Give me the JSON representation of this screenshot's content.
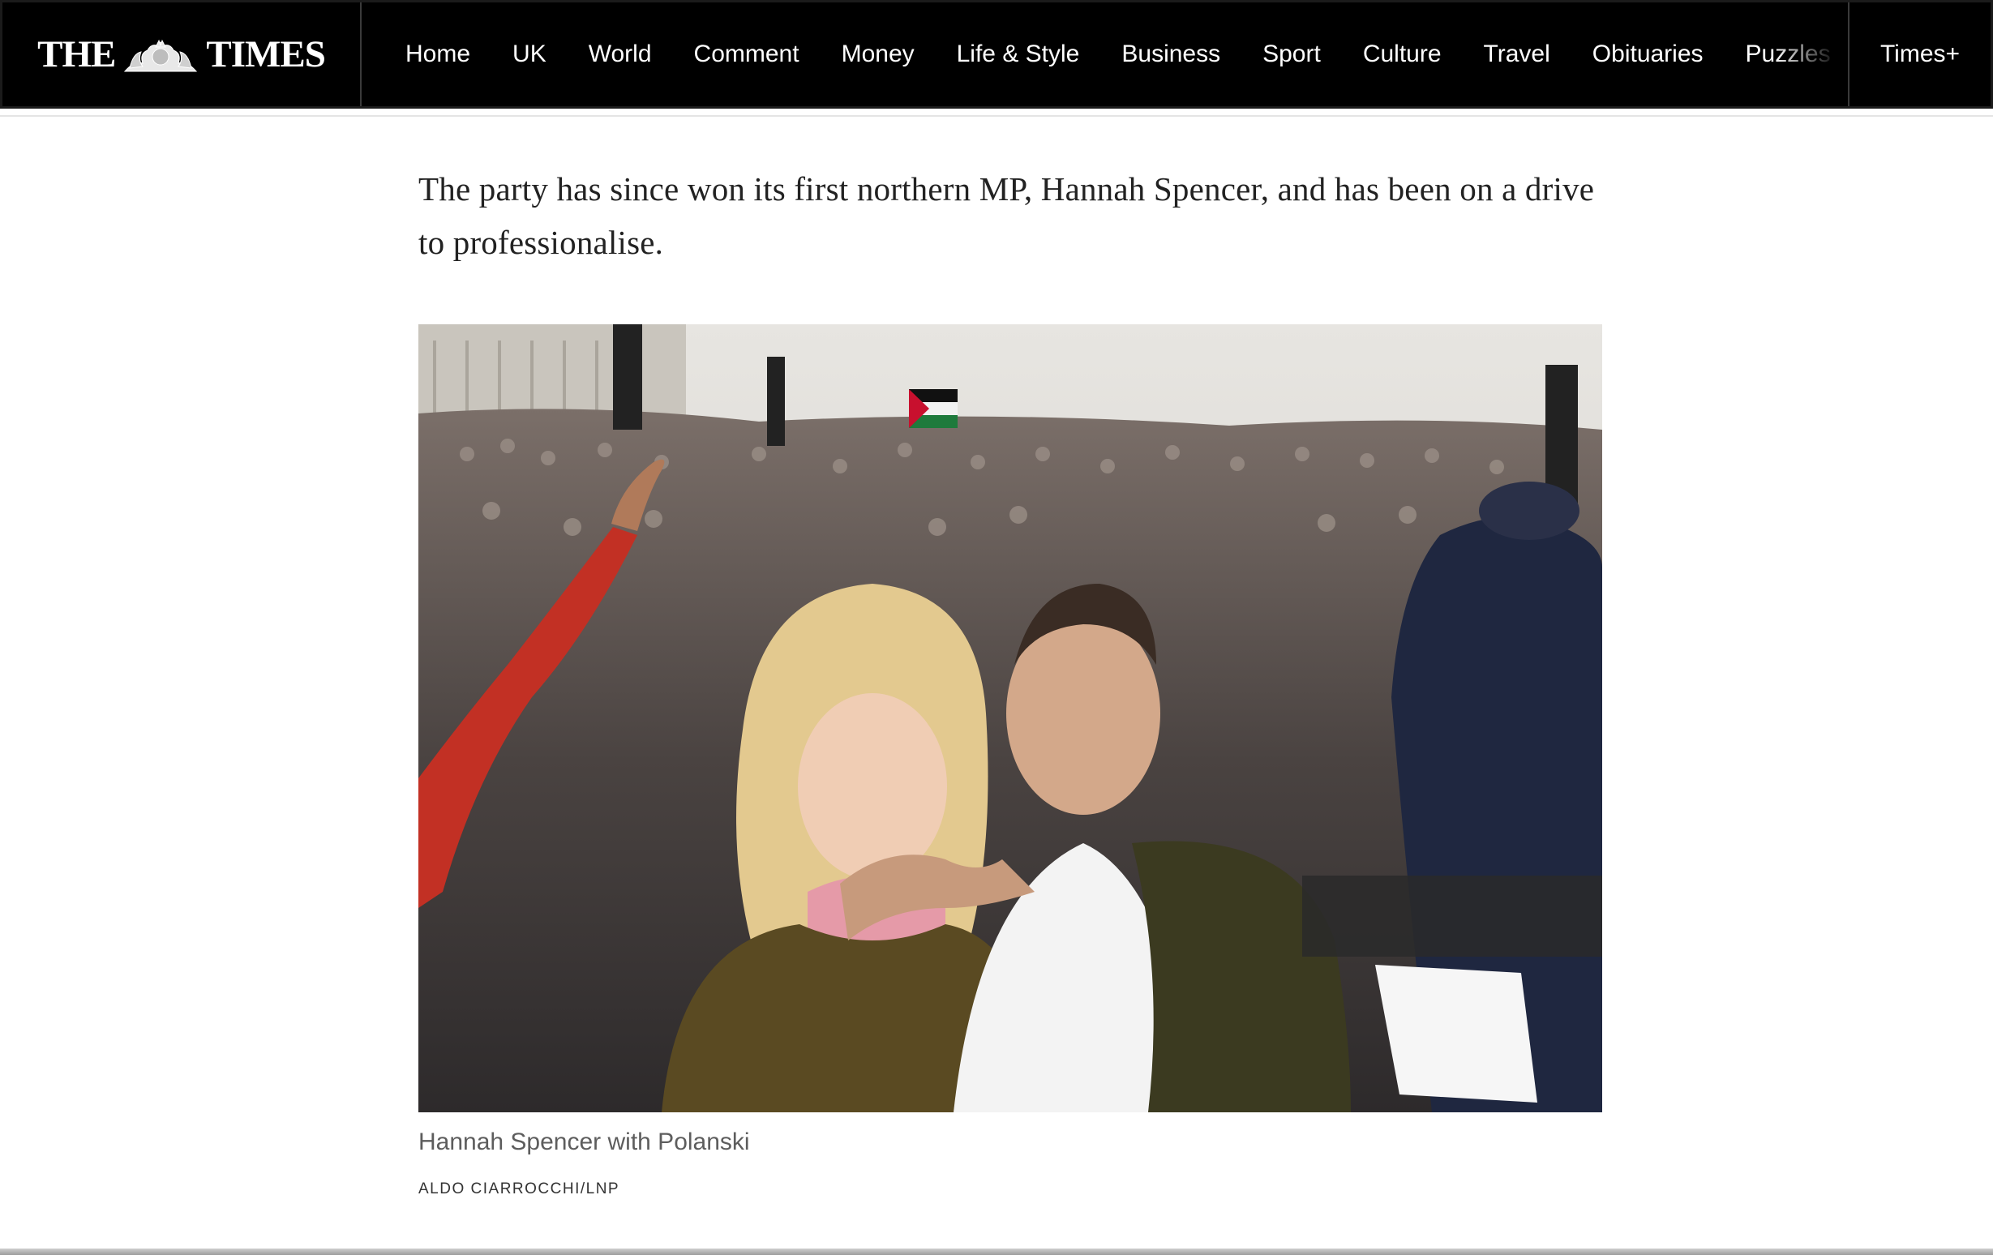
{
  "brand": {
    "logo_left": "THE",
    "logo_right": "TIMES"
  },
  "nav": {
    "items": [
      "Home",
      "UK",
      "World",
      "Comment",
      "Money",
      "Life & Style",
      "Business",
      "Sport",
      "Culture",
      "Travel",
      "Obituaries",
      "Puzzles"
    ],
    "plus_label": "Times+"
  },
  "article": {
    "paragraph": "The party has since won its first northern MP, Hannah Spencer, and has been on a drive to professionalise.",
    "image_caption": "Hannah Spencer with Polanski",
    "image_credit": "ALDO CIARROCCHI/LNP"
  },
  "colors": {
    "nav_background": "#000000",
    "nav_text": "#ffffff",
    "body_text": "#222222",
    "caption_text": "#5d5d5d"
  }
}
